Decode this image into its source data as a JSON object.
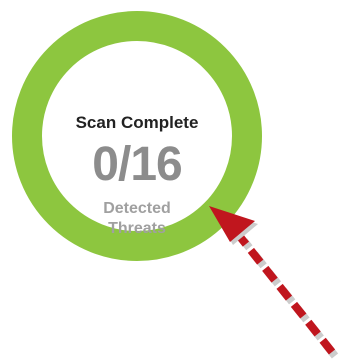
{
  "scan": {
    "title": "Scan Complete",
    "count": "0/16",
    "label_line1": "Detected",
    "label_line2": "Threats"
  },
  "colors": {
    "ring": "#8dc63f",
    "count": "#8c8c8c",
    "label": "#a0a0a0",
    "arrow": "#c0161e"
  },
  "icons": {
    "annotation": "dashed-arrow-icon"
  }
}
